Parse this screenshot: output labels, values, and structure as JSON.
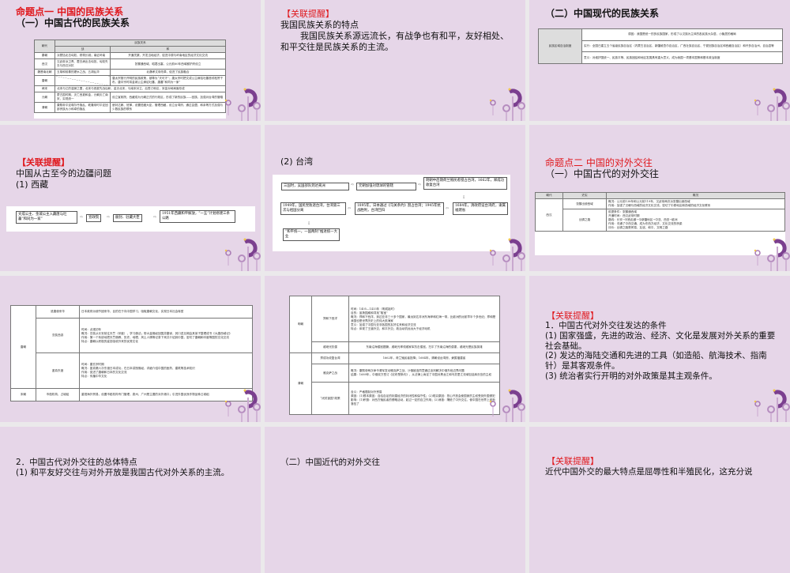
{
  "reminder_label": "【关联提醒】",
  "s1": {
    "title": "命题点一  中国的民族关系",
    "subtitle": "（一）中国古代的民族关系",
    "table": {
      "h_dynasty": "朝代",
      "h_rel": "民族关系",
      "h_war": "战",
      "h_peace": "和",
      "rows": [
        {
          "d": "秦朝",
          "w": "派蒙恬北击匈奴，修筑长城；南征岭南",
          "p": "开通灵渠，开发当地经济，促进中原与岭南地区的经济文化交流"
        },
        {
          "d": "西汉",
          "w": "汉武帝派卫青、霍去病出击匈奴，匈奴失去与西汉对抗",
          "p": "张骞通西域，昭君出塞，公元前60年西域都护府设立"
        },
        {
          "d": "魏晋南北朝",
          "w": "五胡和前秦的淝水之战，五胡乱华",
          "p": "北魏孝文帝改革，促进了民族融合"
        },
        {
          "d": "唐朝",
          "w": "",
          "p": "唐太宗推行开明的民族政策，被尊为“天可汗”；唐太宗时把文成公主嫁给吐蕃首领松赞干布，唐中宗时将金城公主嫁给吐蕃，唐蕃“和同为一家”"
        },
        {
          "d": "两宋",
          "w": "北宋与辽的澶渊之盟，北宋与西夏先战后和，金灭北宋，与南宋对立，后签订和议，宋金对峙局面形成",
          "p": ""
        },
        {
          "d": "元朝",
          "w": "蒙古国时期，灭亡西夏和金，元朝灭亡南宋，实现统一",
          "p": "设立宣政院，西藏成为元朝正式的行政区，形成了新的民族——回族，加强对台湾的管辖"
        },
        {
          "d": "清朝",
          "w": "康熙帝平定噶尔丹叛乱，乾隆帝时平定回部贵族大小和卓的叛乱",
          "p": "册封达赖、班禅，设置驻藏大臣，管理西藏，设立台湾府，通过会盟、和亲等方式加强与少数民族的联系"
        }
      ]
    }
  },
  "s2": {
    "heading": "我国民族关系的特点",
    "para": "我国民族关系源远流长，有战争也有和平，友好相处、和平交往是民族关系的主流。"
  },
  "s3": {
    "title": "（二）中国现代的民族关系",
    "label": "民族区域自治制度",
    "rows": [
      "原因：我国是统一的多民族国家，形成了以汉族为主体的各民族大杂居、小聚居的格局",
      "实行：全国已建立五个省级民族自治区（内蒙古自治区、新疆维吾尔自治区、广西壮族自治区、宁夏回族自治区和西藏自治区）和许多自治州、自治县等",
      "意义：对维护国统一、民族平等、民族团结和地区发展具有重大意义，成为我国一项基本国策和基本政治制度"
    ]
  },
  "s4": {
    "heading": "中国从古至今的边疆问题",
    "sub": "(1) 西藏",
    "flow": [
      "文成公主、金城公主入藏唐与吐蕃“和同为一家”",
      "宣政院",
      "册封、驻藏大臣",
      "1951年西藏和平解放，“一五”计划修建三条公路"
    ]
  },
  "s5": {
    "sub": "(2) 台湾",
    "flow": [
      "三国时，吴国部队到达夷洲",
      "元朝加强对琉球的管辖",
      "明朝中后期荷兰殖民者侵占台湾，1662年，郑成功收复台湾",
      "1684年，清政府设台湾府，隶属福建省",
      "1895年，日本通过《马关条约》割占台湾；1945年抗战胜利，台湾回归",
      "1949年，国民党败退台湾，台湾第三次与祖国分离",
      "“和平统一，一国两制”推进统一大业"
    ]
  },
  "s6": {
    "title": "命题点二  中国的对外交往",
    "subtitle": "（一）中国古代的对外交往",
    "h": [
      "朝代",
      "史实",
      "概况"
    ],
    "dynasty": "西汉",
    "rows": [
      {
        "e": "张骞出使西域",
        "lines": [
          "概况：公元前138年和公元前119年，汉武帝两次派张骞出使西域",
          "作用：加强了汉朝与西域的经济文化交流，密切了中原地区和西域的经济文化联系"
        ]
      },
      {
        "e": "丝绸之路",
        "lines": [
          "前提条件：张骞通西域",
          "开通时间：西汉武帝时期",
          "路线：长安→河西走廊→今新疆地区→中亚、西亚→欧洲",
          "作用：沟通了中西交通，成为东西方经济、文化交流的桥梁",
          "评价：丝绸之路是贸易、友谊、和平、文明之路"
        ]
      }
    ]
  },
  "s7": {
    "rows": [
      {
        "d": "唐朝",
        "e": "遣唐使来华",
        "lines": [
          "日本政府派使节团来华，目的在于向中国学习，吸取唐朝文化，实现日本社会转型"
        ]
      },
      {
        "d": "",
        "e": "玄奘西游",
        "lines": [
          "时间：贞观初年",
          "概况：玄奘从长安前往天竺（印度），学习佛法；带大量佛经回国并翻译，其口述见闻由其弟子整理成书《大唐西域记》",
          "作用：第一个系统地把天竺佛教、历史、地理、风土人情等记录下来并介绍到中国，密切了唐朝和印度等国的文化交流",
          "特点：唐朝以积极的姿态吸收外来的优秀文化"
        ]
      },
      {
        "d": "",
        "e": "鉴真东渡",
        "lines": [
          "时间：唐玄宗时期",
          "概况：鉴真第六次东渡日本成功，在日本讲授佛经，详细介绍中国的医药、建筑等技术知识",
          "作用：促进了唐朝和日本的文化交流",
          "特点：传播中华文化"
        ]
      },
      {
        "d": "宋朝",
        "e": "市舶机构、占城稻",
        "lines": [
          "重视海外贸易，设置市舶机构专门管理，泉州、广州是主要的对外港口；引进外国优良作物品种占城稻"
        ]
      }
    ]
  },
  "s8": {
    "rows": [
      {
        "d": "明朝",
        "e": "郑和下西洋",
        "lines": [
          "时间：1405—1433年（明成祖时）",
          "目的：宣扬国威和寻找“取宝”",
          "概况：郑和下西洋，到过亚非三十多个国家，最远到达非洲东海岸和红海一带，比欧洲的远航早半个多世纪；郑和是我国也是世界历史上的伟大航海家",
          "意义：加强了中国与亚非各国的友好往来和经济交流",
          "特点：体现了王道外交，和平外交；政治动机远远大于经济动机"
        ]
      },
      {
        "d": "",
        "e": "戚继光抗倭",
        "lines": [
          "东南沿海倭寇猖獗，戚继光率领戚家军抗击倭寇，扫平了东南沿海的倭患，戚继光是民族英雄"
        ]
      },
      {
        "d": "清朝",
        "e": "郑成功收复台湾",
        "lines": [
          "1662年，荷兰殖民者投降；1684年，清朝设台湾府，隶属福建省"
        ]
      },
      {
        "d": "",
        "e": "雅克萨之战",
        "lines": [
          "概况：康熙帝两次命令清军发动雅克萨之战，沙俄被迫同意通过谈判解决中俄东段边界问题",
          "结果：1689年，中俄双方签订《尼布楚条约》，从法律上肯定了中国对黑龙江和乌苏里江流域包括库页岛的主权"
        ]
      },
      {
        "d": "",
        "e": "“闭关锁国”政策",
        "lines": [
          "含义：严格限制对外贸易",
          "原因：(1)根本原因：自给自足的封建经济的封闭性和保守性；(2)现实原因：担心开放会使国家的主权受到外国侵犯",
          "影响：(1)积极：对西方殖民者的侵略活动，起过一定的自卫作用；(2)消极：隔绝了中外交往，使中国在世界上逐渐落伍了"
        ]
      }
    ]
  },
  "s9": {
    "h1": "1．中国古代对外交往发达的条件",
    "p1": "(1) 国家强盛，先进的政治、经济、文化是发展对外关系的重要社会基础。",
    "p2": "(2) 发达的海陆交通和先进的工具（如造船、航海技术、指南针）是其客观条件。",
    "p3": "(3) 统治者实行开明的对外政策是其主观条件。"
  },
  "s10": {
    "h1": "2．中国古代对外交往的总体特点",
    "p1": "(1) 和平友好交往与对外开放是我国古代对外关系的主流。"
  },
  "s11": {
    "title": "（二）中国近代的对外交往"
  },
  "s12": {
    "p1": "近代中国外交的最大特点是屈辱性和半殖民化，这充分说"
  },
  "colors": {
    "slide_bg": "#e6d6e8",
    "accent_red": "#e0191e",
    "deco_purple": "#7b3f8f"
  }
}
